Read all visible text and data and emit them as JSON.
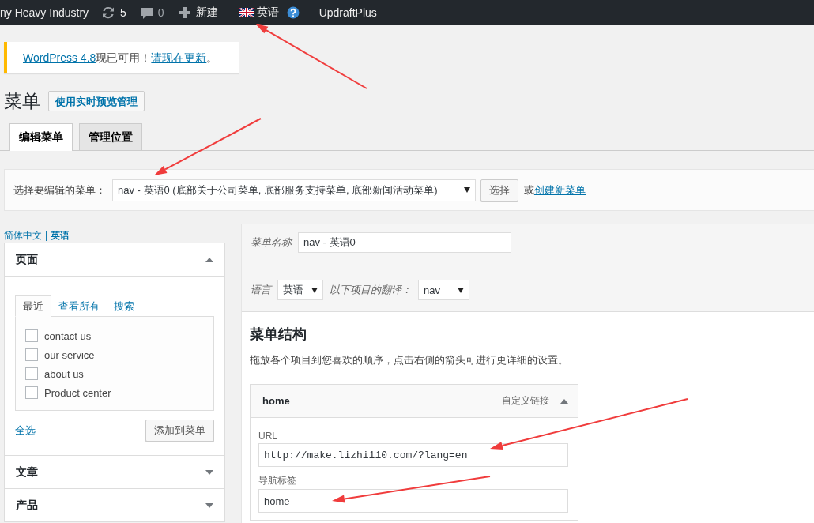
{
  "admin_bar": {
    "site_name": "ny Heavy Industry",
    "updates": "5",
    "comments": "0",
    "new": "新建",
    "language": "英语",
    "plugin": "UpdraftPlus"
  },
  "notice": {
    "link": "WordPress 4.8",
    "text": "现已可用！",
    "action_link": "请现在更新",
    "end": "。"
  },
  "page_title": "菜单",
  "preview_button": "使用实时预览管理",
  "tabs": [
    {
      "label": "编辑菜单",
      "selected": true
    },
    {
      "label": "管理位置",
      "selected": false
    }
  ],
  "menu_select": {
    "label": "选择要编辑的菜单：",
    "value": "nav - 英语0 (底部关于公司菜单, 底部服务支持菜单, 底部新闻活动菜单)",
    "button": "选择",
    "or": "或",
    "create_link": "创建新菜单"
  },
  "languages": [
    {
      "label": "简体中文",
      "selected": false
    },
    {
      "label": "英语",
      "selected": true
    }
  ],
  "language_separator": "|",
  "accordion": [
    {
      "title": "页面",
      "expanded": true,
      "tabs": [
        {
          "label": "最近",
          "selected": true
        },
        {
          "label": "查看所有",
          "selected": false
        },
        {
          "label": "搜索",
          "selected": false
        }
      ],
      "items": [
        {
          "label": "contact us",
          "checked": false
        },
        {
          "label": "our service",
          "checked": false
        },
        {
          "label": "about us",
          "checked": false
        },
        {
          "label": "Product center",
          "checked": false
        }
      ],
      "select_all": "全选",
      "add_button": "添加到菜单"
    },
    {
      "title": "文章",
      "expanded": false
    },
    {
      "title": "产品",
      "expanded": false
    }
  ],
  "menu_settings": {
    "name_label": "菜单名称",
    "name": "nav - 英语0",
    "language_label": "语言",
    "language": "英语",
    "translation_label": "以下项目的翻译：",
    "translation": "nav"
  },
  "structure": {
    "title": "菜单结构",
    "hint": "拖放各个项目到您喜欢的顺序，点击右侧的箭头可进行更详细的设置。",
    "items": [
      {
        "title": "home",
        "type": "自定义链接",
        "expanded": true,
        "url_label": "URL",
        "url": "http://make.lizhi110.com/?lang=en",
        "nav_label_label": "导航标签",
        "nav_label": "home"
      }
    ]
  }
}
